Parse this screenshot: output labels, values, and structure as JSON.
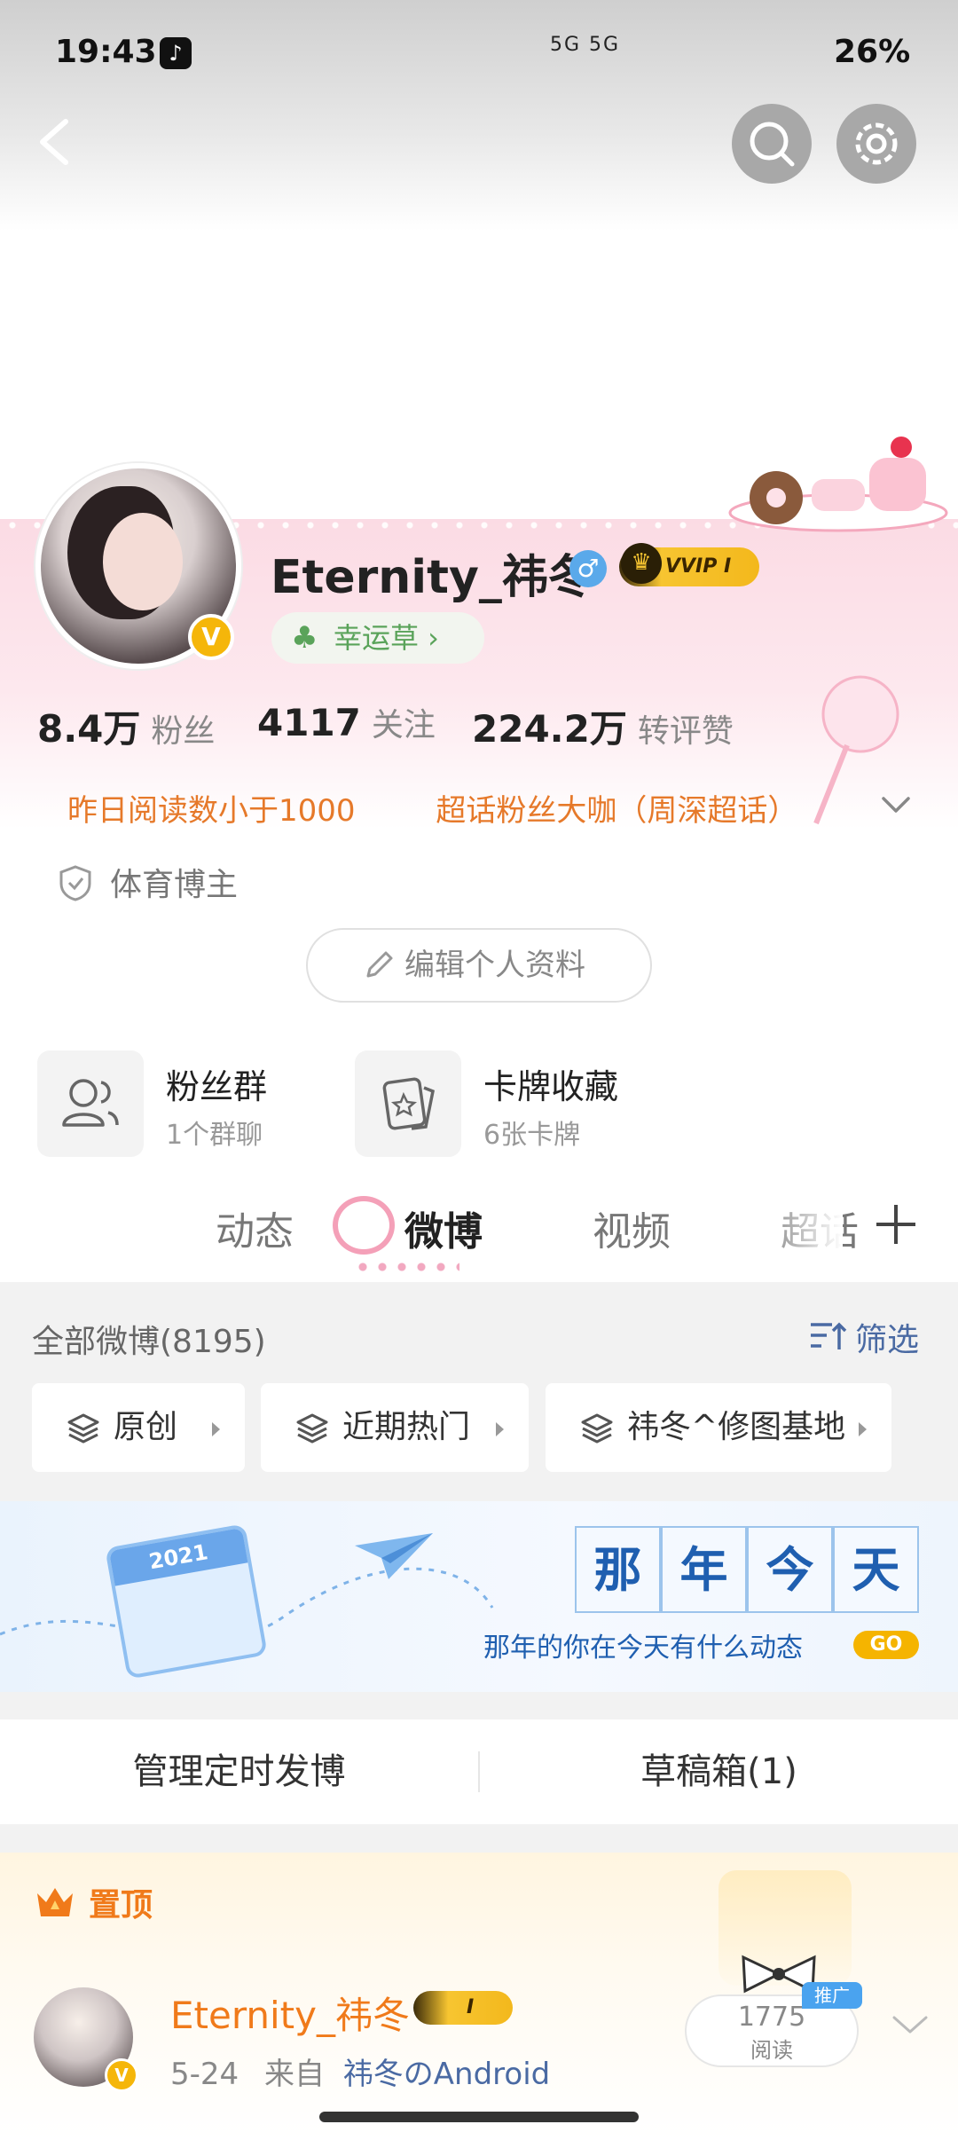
{
  "status_bar": {
    "time": "19:43",
    "network": "5G 5G",
    "battery": "26%"
  },
  "profile": {
    "username": "Eternity_祎冬",
    "vip_label": "VVIP I",
    "verified_mark": "V",
    "lucky_label": "幸运草 ›"
  },
  "stats": [
    {
      "value": "8.4万",
      "label": "粉丝"
    },
    {
      "value": "4117",
      "label": "关注"
    },
    {
      "value": "224.2万",
      "label": "转评赞"
    }
  ],
  "badges": [
    "昨日阅读数小于1000",
    "超话粉丝大咖（周深超话）"
  ],
  "category": "体育博主",
  "edit_profile": "编辑个人资料",
  "features": [
    {
      "title": "粉丝群",
      "sub": "1个群聊"
    },
    {
      "title": "卡牌收藏",
      "sub": "6张卡牌"
    }
  ],
  "tabs": [
    "动态",
    "微博",
    "视频",
    "超话"
  ],
  "filter": {
    "all_label": "全部微博(8195)",
    "filter_label": "筛选",
    "chips": [
      "原创",
      "近期热门",
      "祎冬^修图基地"
    ]
  },
  "memory_banner": {
    "title_chars": [
      "那",
      "年",
      "今",
      "天"
    ],
    "subtitle": "那年的你在今天有什么动态",
    "go": "GO",
    "calendar_year": "2021"
  },
  "manage": {
    "scheduled": "管理定时发博",
    "drafts": "草稿箱(1)"
  },
  "pinned": {
    "label": "置顶",
    "author": "Eternity_祎冬",
    "vip_label": "I",
    "date": "5-24",
    "from_label": "来自",
    "source": "祎冬のAndroid",
    "reads": "1775",
    "reads_label": "阅读",
    "promo": "推广"
  },
  "colors": {
    "accent_orange": "#f07a1a",
    "link_blue": "#4a6aa3",
    "gold": "#f5b60a"
  }
}
